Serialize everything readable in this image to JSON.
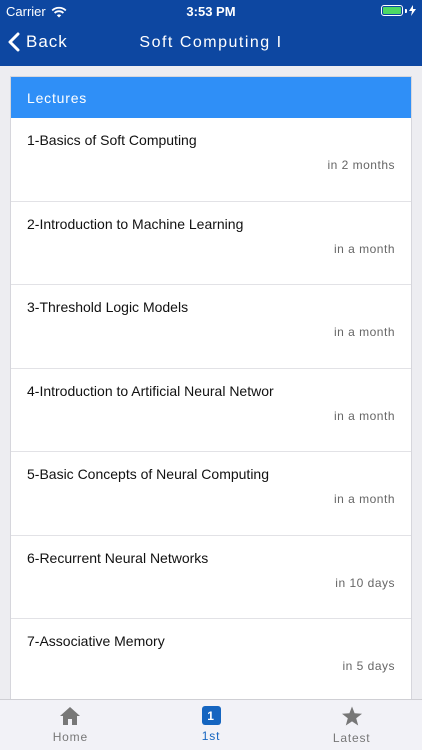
{
  "status_bar": {
    "carrier": "Carrier",
    "time": "3:53 PM"
  },
  "nav": {
    "back_label": "Back",
    "title": "Soft Computing I"
  },
  "section": {
    "header": "Lectures"
  },
  "lectures": [
    {
      "title": "1-Basics of Soft Computing",
      "due": "in 2 months"
    },
    {
      "title": "2-Introduction to Machine Learning",
      "due": "in a month"
    },
    {
      "title": "3-Threshold Logic Models",
      "due": "in a month"
    },
    {
      "title": "4-Introduction to Artificial Neural Networ",
      "due": "in a month"
    },
    {
      "title": "5-Basic Concepts of Neural Computing",
      "due": "in a month"
    },
    {
      "title": "6-Recurrent Neural Networks",
      "due": "in 10 days"
    },
    {
      "title": "7-Associative Memory",
      "due": "in 5 days"
    }
  ],
  "tabs": [
    {
      "label": "Home",
      "icon": "home-icon"
    },
    {
      "label": "1st",
      "icon": "number-one-icon",
      "badge": "1"
    },
    {
      "label": "Latest",
      "icon": "star-icon"
    }
  ],
  "colors": {
    "nav_bg": "#0d47a1",
    "header_bg": "#2f8ff7",
    "active_tab": "#1565c0"
  }
}
